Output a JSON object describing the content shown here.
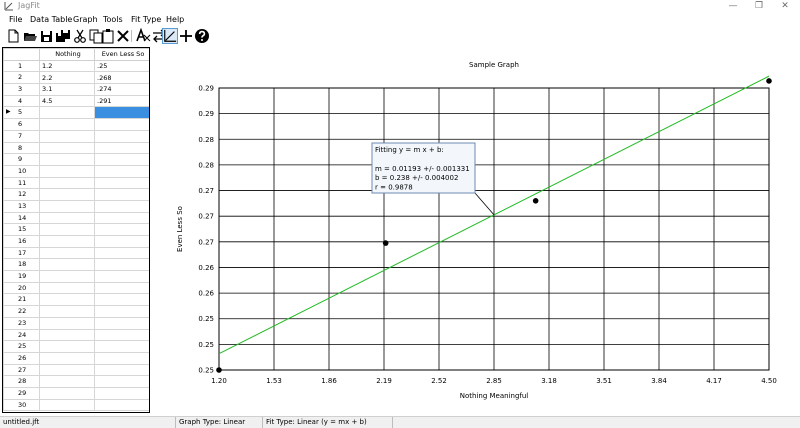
{
  "window": {
    "title": "JagFit",
    "minimize": "—",
    "maximize": "❐",
    "close": "✕"
  },
  "menu": [
    "File",
    "Data Table",
    "Graph",
    "Tools",
    "Fit Type",
    "Help"
  ],
  "toolbar": {
    "icons": [
      "new-file-icon",
      "open-folder-icon",
      "save-icon",
      "save-all-icon",
      "cut-icon",
      "copy-icon",
      "paste-icon",
      "delete-icon",
      "font-icon",
      "swap-icon",
      "graph-icon",
      "add-icon",
      "help-icon"
    ],
    "active": "graph-icon"
  },
  "table": {
    "columns": [
      "Nothing",
      "Even Less So"
    ],
    "rows": [
      [
        "1.2",
        ".25"
      ],
      [
        "2.2",
        ".268"
      ],
      [
        "3.1",
        ".274"
      ],
      [
        "4.5",
        ".291"
      ]
    ],
    "row_count": 30,
    "current_row": 5,
    "current_row_marker": "▶"
  },
  "chart_data": {
    "type": "scatter",
    "title": "Sample Graph",
    "xlabel": "Nothing Meaningful",
    "ylabel": "Even Less So",
    "xlim": [
      1.2,
      4.5
    ],
    "ylim": [
      0.25,
      0.29
    ],
    "x_ticks": [
      "1.20",
      "1.53",
      "1.86",
      "2.19",
      "2.52",
      "2.85",
      "3.18",
      "3.51",
      "3.84",
      "4.17",
      "4.50"
    ],
    "y_ticks": [
      "0.25",
      "0.25",
      "0.25",
      "0.26",
      "0.26",
      "0.27",
      "0.27",
      "0.27",
      "0.28",
      "0.28",
      "0.29",
      "0.29"
    ],
    "grid": true,
    "series": [
      {
        "x": [
          1.2,
          2.2,
          3.1,
          4.5
        ],
        "y": [
          0.25,
          0.268,
          0.274,
          0.291
        ],
        "color": "#000000"
      }
    ],
    "fit": {
      "slope": 0.01193,
      "intercept": 0.238,
      "color": "#22bb22",
      "lines": [
        "Fitting y = m x + b:",
        "",
        "m = 0.01193 +/- 0.001331",
        "b = 0.238 +/- 0.004002",
        "r = 0.9878"
      ],
      "pointer_x": 2.85
    }
  },
  "status": {
    "file": "untitled.jft",
    "graph_type": "Graph Type: Linear",
    "fit_type": "Fit Type: Linear (y = mx + b)"
  }
}
